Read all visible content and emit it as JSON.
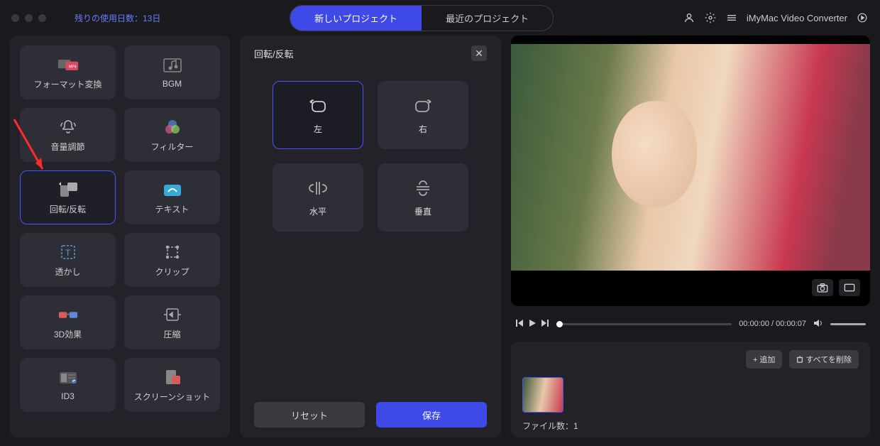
{
  "header": {
    "trial_days": "残りの使用日数：13日",
    "tabs": {
      "new_project": "新しいプロジェクト",
      "recent": "最近のプロジェクト"
    },
    "app_name": "iMyMac Video Converter"
  },
  "tools": [
    {
      "label": "フォーマット変換",
      "key": "format"
    },
    {
      "label": "BGM",
      "key": "bgm"
    },
    {
      "label": "音量調節",
      "key": "volume"
    },
    {
      "label": "フィルター",
      "key": "filter"
    },
    {
      "label": "回転/反転",
      "key": "rotate"
    },
    {
      "label": "テキスト",
      "key": "text"
    },
    {
      "label": "透かし",
      "key": "watermark"
    },
    {
      "label": "クリップ",
      "key": "clip"
    },
    {
      "label": "3D効果",
      "key": "3d"
    },
    {
      "label": "圧縮",
      "key": "compress"
    },
    {
      "label": "ID3",
      "key": "id3"
    },
    {
      "label": "スクリーンショット",
      "key": "screenshot"
    }
  ],
  "panel": {
    "title": "回転/反転",
    "options": {
      "left": "左",
      "right": "右",
      "horizontal": "水平",
      "vertical": "垂直"
    },
    "reset": "リセット",
    "save": "保存"
  },
  "playback": {
    "current": "00:00:00",
    "total": "00:00:07",
    "time_display": "00:00:00 / 00:00:07"
  },
  "filebar": {
    "add": "+ 追加",
    "delete_all": "すべてを削除",
    "count_label": "ファイル数：1"
  }
}
